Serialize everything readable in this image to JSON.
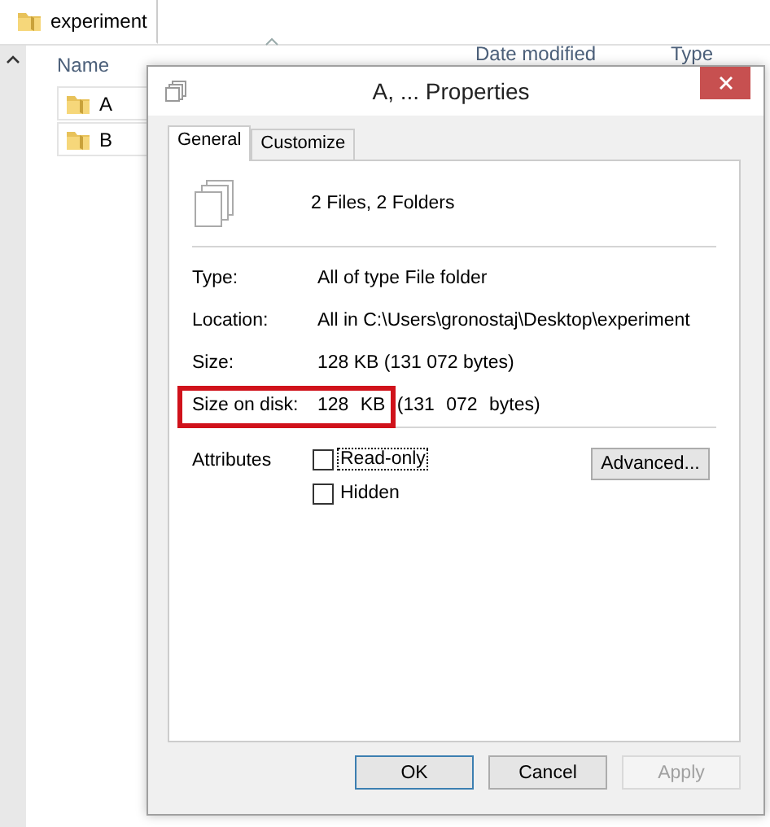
{
  "explorer": {
    "tab": "experiment",
    "columns": [
      "Name",
      "Date modified",
      "Type"
    ],
    "rows": [
      {
        "name": "A"
      },
      {
        "name": "B"
      }
    ]
  },
  "dialog": {
    "title": "A, ... Properties",
    "tabs": [
      {
        "label": "General",
        "selected": true
      },
      {
        "label": "Customize",
        "selected": false
      }
    ],
    "summary": "2 Files, 2 Folders",
    "properties": [
      {
        "label": "Type:",
        "value": "All of type File folder",
        "highlighted": false
      },
      {
        "label": "Location:",
        "value": "All in C:\\Users\\gronostaj\\Desktop\\experiment",
        "highlighted": false
      },
      {
        "label": "Size:",
        "value": "128 KB (131 072 bytes)",
        "highlighted": false
      },
      {
        "label": "Size on disk:",
        "value": "128 KB (131 072 bytes)",
        "highlighted": true
      }
    ],
    "attributes_label": "Attributes",
    "attributes": [
      {
        "label": "Read-only",
        "checked": false,
        "focused": true
      },
      {
        "label": "Hidden",
        "checked": false,
        "focused": false
      }
    ],
    "advanced_button": "Advanced...",
    "buttons": [
      {
        "label": "OK",
        "kind": "default"
      },
      {
        "label": "Cancel",
        "kind": "normal"
      },
      {
        "label": "Apply",
        "kind": "disabled"
      }
    ]
  }
}
